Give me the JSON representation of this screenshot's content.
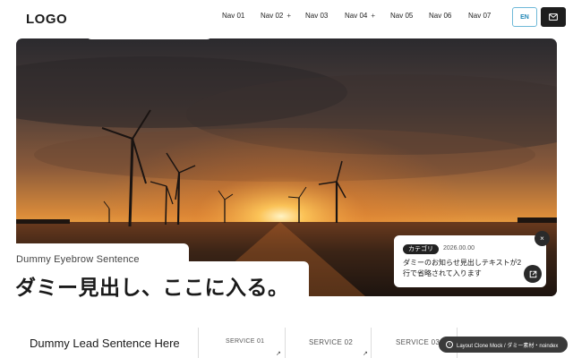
{
  "header": {
    "logo": "LOGO",
    "nav": [
      {
        "label": "Nav 01",
        "has_sub": false
      },
      {
        "label": "Nav 02",
        "has_sub": true
      },
      {
        "label": "Nav 03",
        "has_sub": false
      },
      {
        "label": "Nav 04",
        "has_sub": true
      },
      {
        "label": "Nav 05",
        "has_sub": false
      },
      {
        "label": "Nav 06",
        "has_sub": false
      },
      {
        "label": "Nav 07",
        "has_sub": false
      }
    ],
    "plus_symbol": "+",
    "lang_label": "EN",
    "mail_icon": "mail-icon"
  },
  "hero": {
    "eyebrow": "Dummy Eyebrow Sentence",
    "headline": "ダミー見出し、ここに入る。",
    "image_icon": "wind-turbine-sunset-photo"
  },
  "news": {
    "tag": "カテゴリ",
    "date": "2026.00.00",
    "title": "ダミーのお知らせ見出しテキストが2行で省略されて入ります",
    "close_label": "×",
    "open_icon": "external-link-icon"
  },
  "bottom": {
    "lead": "Dummy Lead Sentence Here",
    "services": [
      {
        "label": "SERVICE 01"
      },
      {
        "label": "SERVICE 02"
      },
      {
        "label": "SERVICE 03"
      }
    ],
    "arrow": "↗",
    "badge": "Layout Clone Mock / ダミー素材・noindex",
    "badge_info": "i"
  },
  "colors": {
    "accent_blue": "#1f86b6",
    "dark": "#1e1e1e"
  }
}
